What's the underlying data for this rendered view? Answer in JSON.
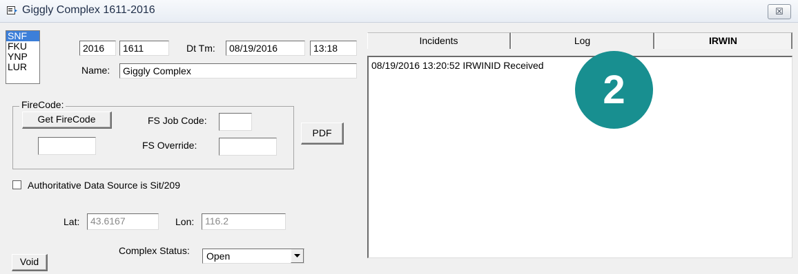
{
  "window": {
    "title": "Giggly Complex 1611-2016",
    "close_glyph": "☒"
  },
  "units_list": {
    "items": [
      "SNF",
      "FKU",
      "YNP",
      "LUR"
    ],
    "selected": "SNF"
  },
  "header_fields": {
    "year": "2016",
    "number": "1611",
    "dttm_label": "Dt Tm:",
    "date": "08/19/2016",
    "time": "13:18",
    "name_label": "Name:",
    "name": "Giggly Complex"
  },
  "firecode": {
    "group_label": "FireCode:",
    "get_button": "Get FireCode",
    "firecode_value": "",
    "fs_job_code_label": "FS Job Code:",
    "fs_job_code_value": "",
    "fs_override_label": "FS Override:",
    "fs_override_value": ""
  },
  "pdf_button": "PDF",
  "authoritative": {
    "label": "Authoritative Data Source is Sit/209",
    "checked": false
  },
  "location": {
    "lat_label": "Lat:",
    "lat": "43.6167",
    "lon_label": "Lon:",
    "lon": "116.2"
  },
  "void_button": "Void",
  "complex_status": {
    "label": "Complex Status:",
    "value": "Open"
  },
  "tabs": [
    {
      "label": "Incidents"
    },
    {
      "label": "Log"
    },
    {
      "label": "IRWIN"
    }
  ],
  "active_tab": "IRWIN",
  "irwin_log": [
    "08/19/2016 13:20:52 IRWINID Received"
  ],
  "callout": {
    "number": "2"
  },
  "colors": {
    "selection": "#3c7fd9",
    "callout": "#188f90"
  }
}
